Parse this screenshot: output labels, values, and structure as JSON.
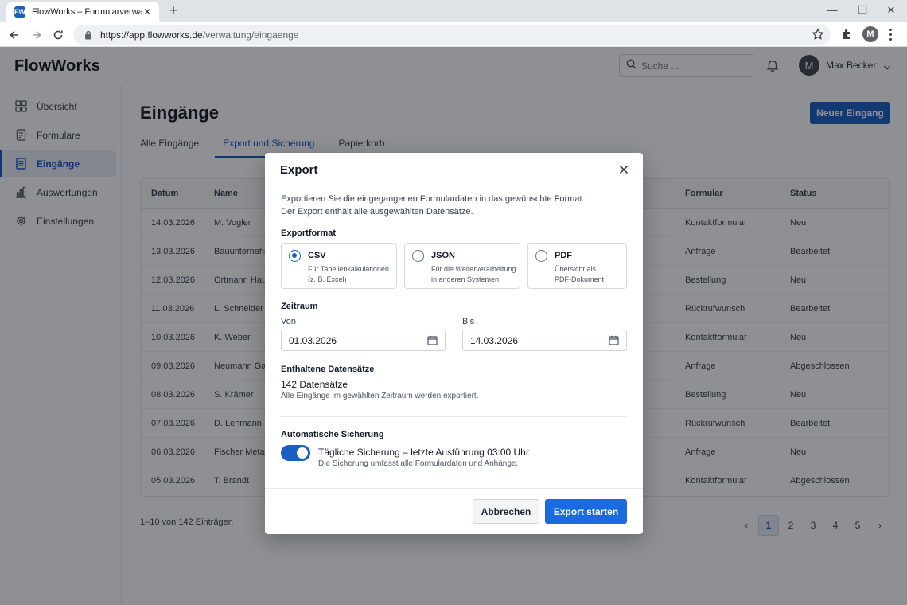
{
  "browser": {
    "tab_title": "FlowWorks – Formularverwaltung",
    "tab_favicon": "FW",
    "url_host": "https://app.flowworks.de",
    "url_path": "/verwaltung/eingaenge",
    "profile_initial": "M"
  },
  "app": {
    "brand": "FlowWorks",
    "search_placeholder": "Suche ...",
    "user_initial": "M",
    "user_name": "Max Becker",
    "accent_color": "#1a5fc4"
  },
  "sidebar": {
    "items": [
      {
        "label": "Übersicht",
        "icon": "grid-icon"
      },
      {
        "label": "Formulare",
        "icon": "document-icon"
      },
      {
        "label": "Eingänge",
        "icon": "inbox-list-icon",
        "active": true
      },
      {
        "label": "Auswertungen",
        "icon": "bar-chart-icon"
      },
      {
        "label": "Einstellungen",
        "icon": "gear-icon"
      }
    ]
  },
  "main": {
    "title": "Eingänge",
    "new_button": "Neuer Eingang",
    "tabs": [
      "Alle Eingänge",
      "Export und Sicherung",
      "Papierkorb"
    ],
    "active_tab": 1,
    "table": {
      "headers": {
        "date": "Datum",
        "name": "Name",
        "form": "Formular",
        "status": "Status"
      },
      "rows": [
        {
          "date": "14.03.2026",
          "name": "M. Vogler",
          "form": "Kontaktformular",
          "status": "Neu"
        },
        {
          "date": "13.03.2026",
          "name": "Bauunternehm",
          "form": "Anfrage",
          "status": "Bearbeitet"
        },
        {
          "date": "12.03.2026",
          "name": "Ortmann Haust",
          "form": "Bestellung",
          "status": "Neu"
        },
        {
          "date": "11.03.2026",
          "name": "L. Schneider",
          "form": "Rückrufwunsch",
          "status": "Bearbeitet"
        },
        {
          "date": "10.03.2026",
          "name": "K. Weber",
          "form": "Kontaktformular",
          "status": "Neu"
        },
        {
          "date": "09.03.2026",
          "name": "Neumann Gart",
          "form": "Anfrage",
          "status": "Abgeschlossen"
        },
        {
          "date": "08.03.2026",
          "name": "S. Krämer",
          "form": "Bestellung",
          "status": "Neu"
        },
        {
          "date": "07.03.2026",
          "name": "D. Lehmann",
          "form": "Rückrufwunsch",
          "status": "Bearbeitet"
        },
        {
          "date": "06.03.2026",
          "name": "Fischer Metallt",
          "form": "Anfrage",
          "status": "Neu"
        },
        {
          "date": "05.03.2026",
          "name": "T. Brandt",
          "form": "Kontaktformular",
          "status": "Abgeschlossen"
        }
      ]
    },
    "count_text": "1–10 von 142 Einträgen",
    "pagination": {
      "pages": [
        "1",
        "2",
        "3",
        "4",
        "5"
      ],
      "current": "1",
      "prev": "‹",
      "next": "›"
    }
  },
  "modal": {
    "title": "Export",
    "intro_line1": "Exportieren Sie die eingegangenen Formulardaten in das gewünschte Format.",
    "intro_line2": "Der Export enthält alle ausgewählten Datensätze.",
    "format_label": "Exportformat",
    "formats": [
      {
        "name": "CSV",
        "desc1": "Für Tabellenkalkulationen",
        "desc2": "(z. B. Excel)",
        "selected": true
      },
      {
        "name": "JSON",
        "desc1": "Für die Weiterverarbeitung",
        "desc2": "in anderen Systemen",
        "selected": false
      },
      {
        "name": "PDF",
        "desc1": "Übersicht als",
        "desc2": "PDF-Dokument",
        "selected": false
      }
    ],
    "range_label": "Zeitraum",
    "from_label": "Von",
    "from_value": "01.03.2026",
    "to_label": "Bis",
    "to_value": "14.03.2026",
    "records_label": "Enthaltene Datensätze",
    "records_count": "142 Datensätze",
    "records_note": "Alle Eingänge im gewählten Zeitraum werden exportiert.",
    "backup_label": "Automatische Sicherung",
    "backup_enabled": true,
    "backup_text": "Tägliche Sicherung – letzte Ausführung 03:00 Uhr",
    "backup_note": "Die Sicherung umfasst alle Formulardaten und Anhänge.",
    "cancel_label": "Abbrechen",
    "start_label": "Export starten"
  }
}
